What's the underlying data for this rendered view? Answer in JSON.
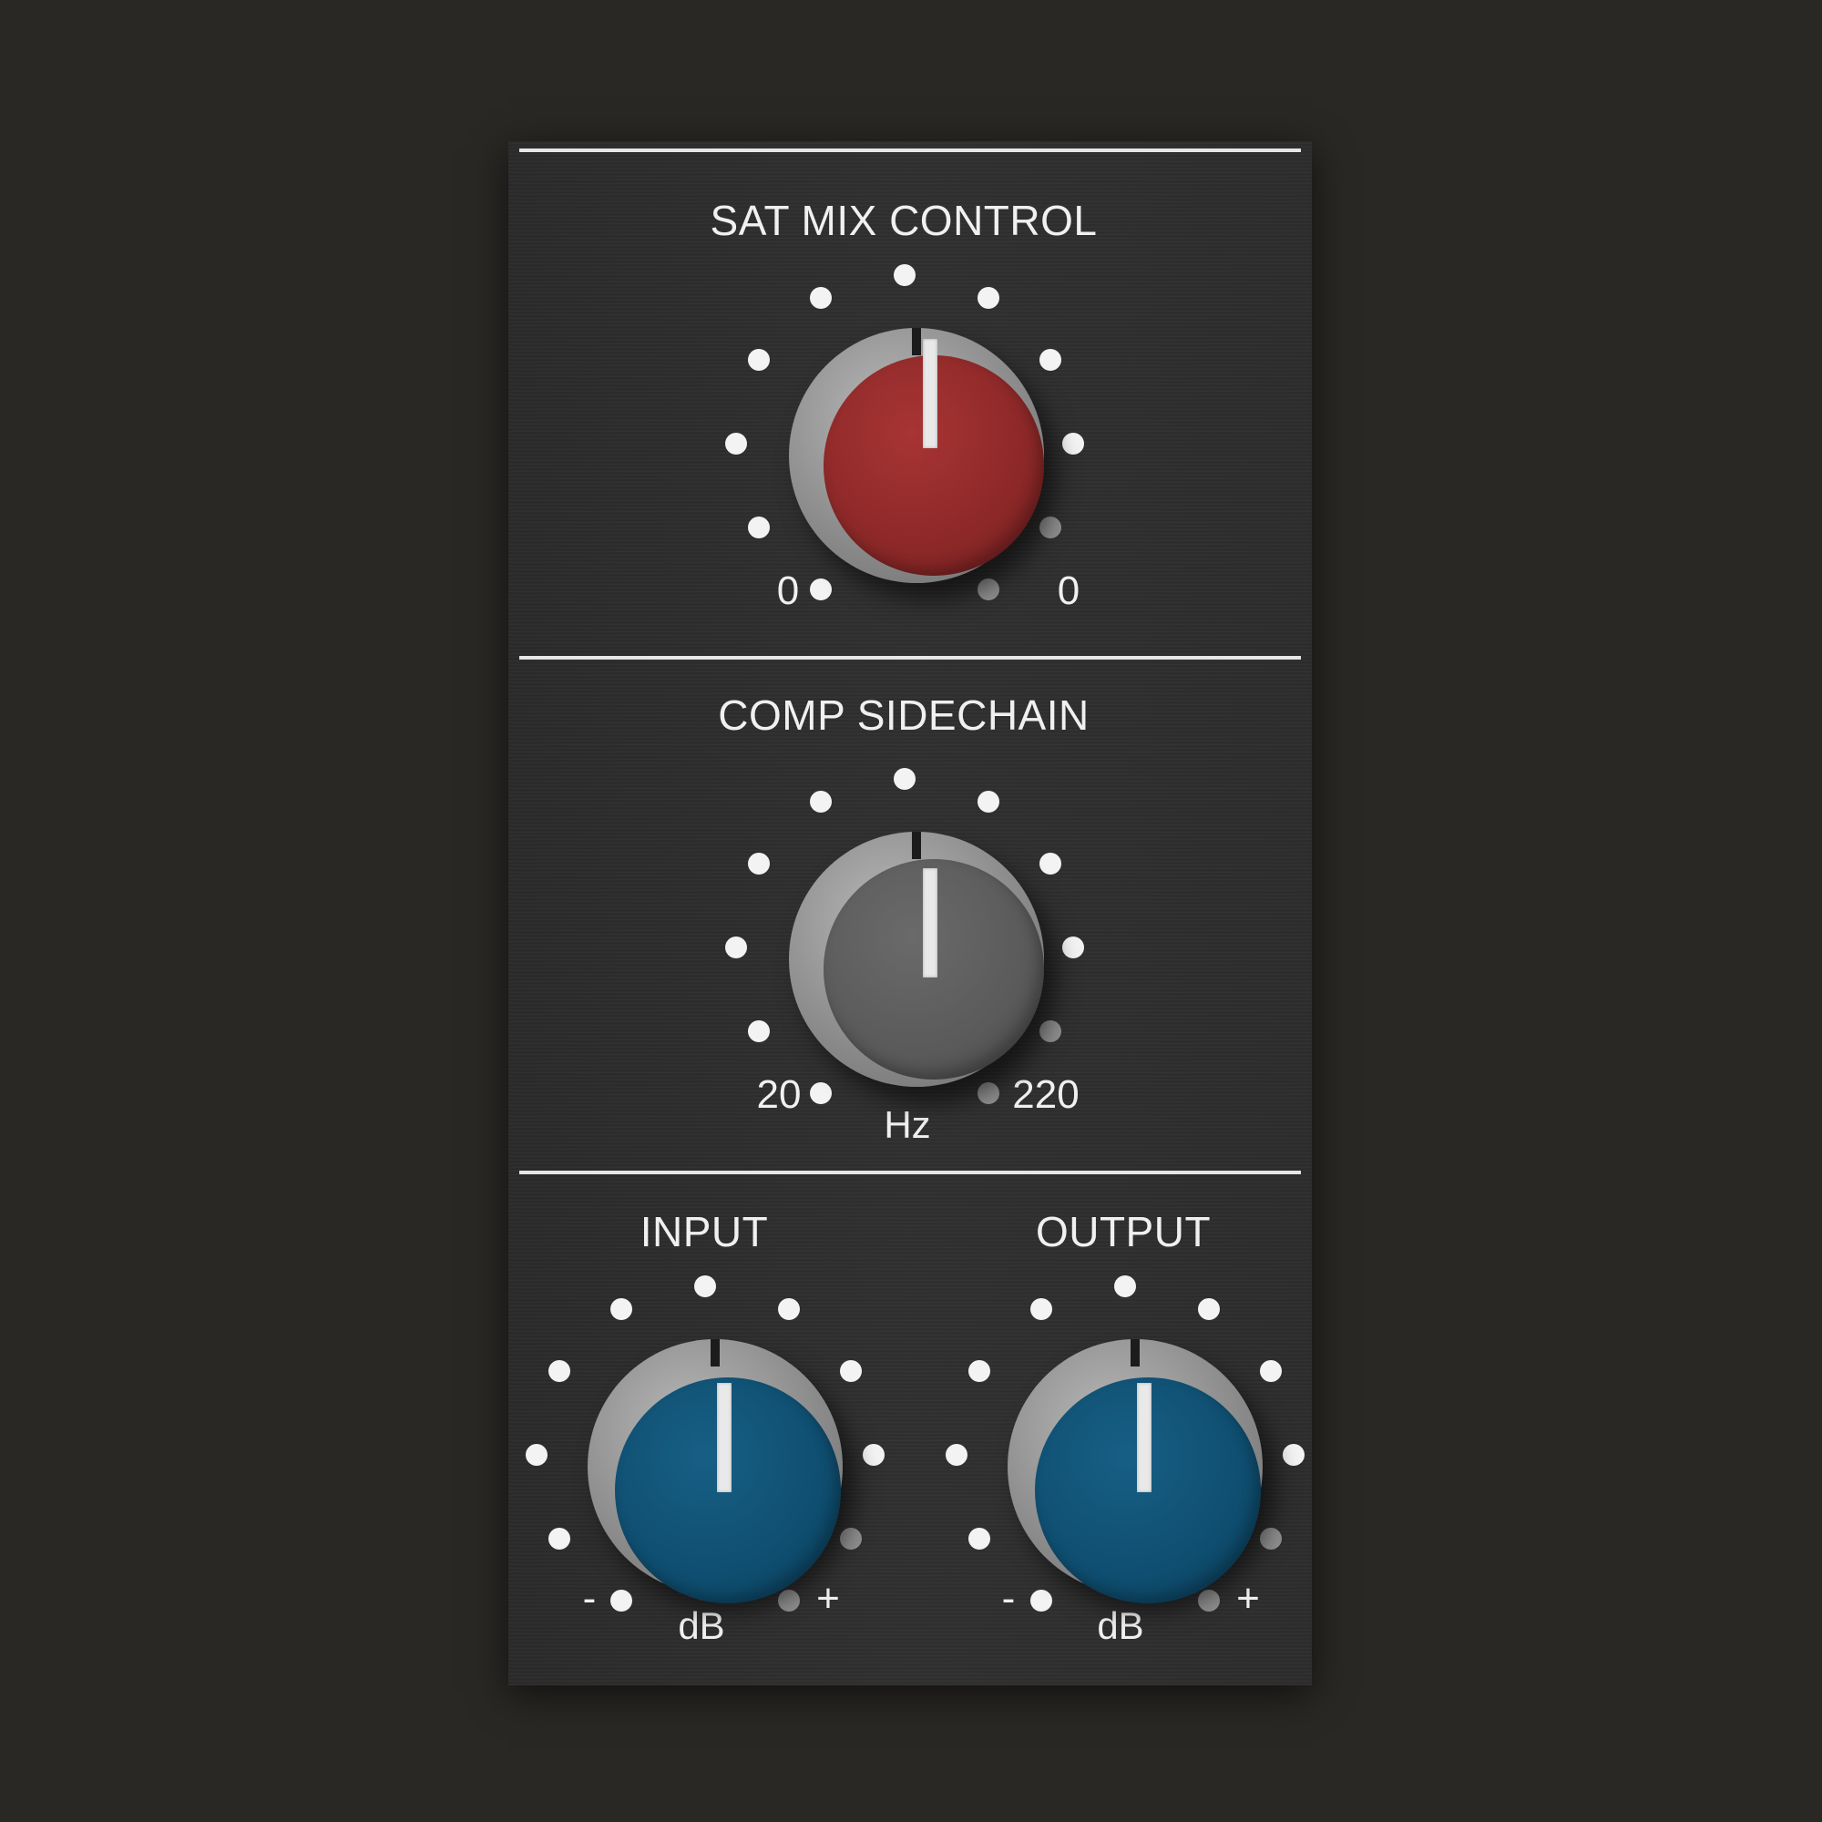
{
  "sections": {
    "sat_mix": {
      "title": "SAT MIX CONTROL",
      "scale_min": "0",
      "scale_max": "0",
      "knob_color": "#8c2828"
    },
    "comp_sidechain": {
      "title": "COMP SIDECHAIN",
      "scale_min": "20",
      "scale_max": "220",
      "unit": "Hz",
      "knob_color": "#5a5a5a"
    },
    "input": {
      "title": "INPUT",
      "scale_min": "-",
      "scale_max": "+",
      "unit": "dB",
      "knob_color": "#0f4e70"
    },
    "output": {
      "title": "OUTPUT",
      "scale_min": "-",
      "scale_max": "+",
      "unit": "dB",
      "knob_color": "#0f4e70"
    }
  }
}
